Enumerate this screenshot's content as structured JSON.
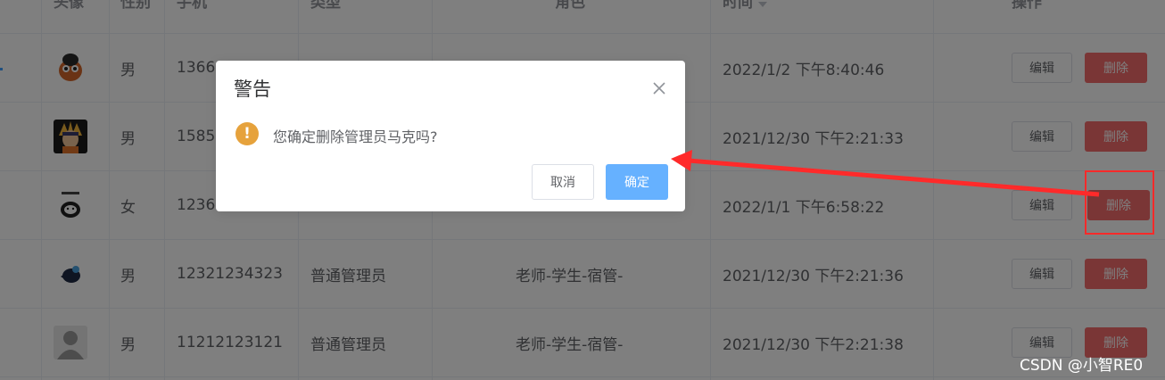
{
  "table": {
    "headers": {
      "avatar": "头像",
      "gender": "性别",
      "phone": "手机",
      "type": "类型",
      "role": "角色",
      "time": "时间",
      "actions": "操作"
    },
    "rows": [
      {
        "gender": "男",
        "phone": "1366",
        "type": "",
        "role": "",
        "time": "2022/1/2 下午8:40:46"
      },
      {
        "gender": "男",
        "phone": "1585",
        "type": "",
        "role": "",
        "time": "2021/12/30 下午2:21:33"
      },
      {
        "gender": "女",
        "phone": "1236",
        "type": "",
        "role": "",
        "time": "2022/1/1 下午6:58:22"
      },
      {
        "gender": "男",
        "phone": "12321234323",
        "type": "普通管理员",
        "role": "老师-学生-宿管-",
        "time": "2021/12/30 下午2:21:36"
      },
      {
        "gender": "男",
        "phone": "11212123121",
        "type": "普通管理员",
        "role": "老师-学生-宿管-",
        "time": "2021/12/30 下午2:21:38"
      }
    ],
    "edit_label": "编辑",
    "delete_label": "删除"
  },
  "dialog": {
    "title": "警告",
    "message": "您确定删除管理员马克吗?",
    "icon": "warning-icon",
    "cancel_label": "取消",
    "confirm_label": "确定"
  },
  "watermark": "CSDN @小智RE0",
  "colors": {
    "danger": "#f56c6c",
    "primary_light": "#66b1ff",
    "warning": "#e6a23c",
    "annotation": "#ff2a2a"
  }
}
